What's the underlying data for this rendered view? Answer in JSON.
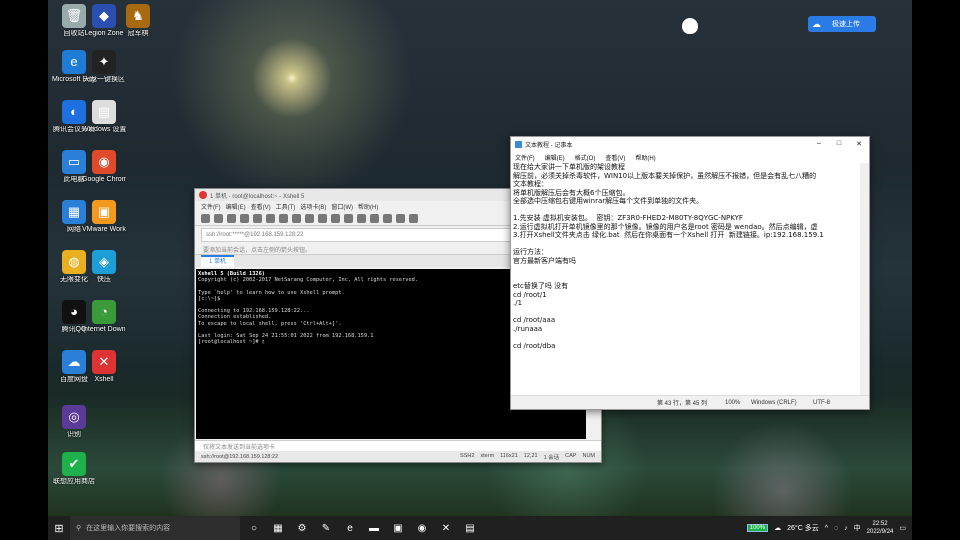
{
  "desktop": {
    "icons": [
      {
        "label": "回收站",
        "icon": "recycle-bin-icon",
        "glyph": "🗑",
        "color": "#9aa"
      },
      {
        "label": "Legion Zone",
        "icon": "legion-zone-icon",
        "glyph": "◆",
        "color": "#2a4fb0"
      },
      {
        "label": "冠军棋",
        "icon": "champion-chess-icon",
        "glyph": "♞",
        "color": "#a86a10"
      },
      {
        "label": "Microsoft Edge",
        "icon": "edge-icon",
        "glyph": "e",
        "color": "#1e7bd6"
      },
      {
        "label": "天龙一键换区",
        "icon": "tianlong-icon",
        "glyph": "✦",
        "color": "#222"
      },
      {
        "label": "腾讯会议开发",
        "icon": "tencent-meeting-icon",
        "glyph": "◐",
        "color": "#1e6fe0"
      },
      {
        "label": "Windows 设置 - 快...",
        "icon": "windows-settings-icon",
        "glyph": "▤",
        "color": "#ddd"
      },
      {
        "label": "此电脑",
        "icon": "this-pc-icon",
        "glyph": "▭",
        "color": "#2a7fd8"
      },
      {
        "label": "Google Chrome",
        "icon": "chrome-icon",
        "glyph": "◉",
        "color": "#e04a2a"
      },
      {
        "label": "网络",
        "icon": "network-icon",
        "glyph": "▦",
        "color": "#2a7fd8"
      },
      {
        "label": "VMware Workstation",
        "icon": "vmware-icon",
        "glyph": "▣",
        "color": "#f39a1e"
      },
      {
        "label": "无限变化",
        "icon": "game-icon",
        "glyph": "◍",
        "color": "#e8b01e"
      },
      {
        "label": "快压",
        "icon": "kuaiya-icon",
        "glyph": "◈",
        "color": "#1e9ed8"
      },
      {
        "label": "腾讯QQ",
        "icon": "qq-icon",
        "glyph": "◕",
        "color": "#111"
      },
      {
        "label": "Internet Download",
        "icon": "idm-icon",
        "glyph": "◔",
        "color": "#3a9a3a"
      },
      {
        "label": "百度网盘",
        "icon": "baidu-netdisk-icon",
        "glyph": "☁",
        "color": "#2a7fd8"
      },
      {
        "label": "Xshell",
        "icon": "xshell-icon",
        "glyph": "✕",
        "color": "#d33"
      },
      {
        "label": "识别",
        "icon": "recognition-icon",
        "glyph": "◎",
        "color": "#5b3a9a"
      },
      {
        "label": "联想应用商店",
        "icon": "lenovo-store-icon",
        "glyph": "✔",
        "color": "#1eb04a"
      }
    ],
    "upload_button": "极速上传"
  },
  "xshell": {
    "title": "1 单机 - root@localhost:~ - Xshell 5",
    "menu": [
      "文件(F)",
      "编辑(E)",
      "查看(V)",
      "工具(T)",
      "选项卡(B)",
      "窗口(W)",
      "帮助(H)"
    ],
    "address": "ssh://root:*****@192.168.159.128:22",
    "hint": "要添加当前会话，点击左侧的箭头按钮。",
    "tab": "1 单机",
    "terminal": [
      {
        "text": "Xshell 5 (Build 1326)",
        "bold": true
      },
      {
        "text": "Copyright (c) 2002-2017 NetSarang Computer, Inc. All rights reserved.",
        "bold": false
      },
      {
        "text": "",
        "bold": false
      },
      {
        "text": "Type `help' to learn how to use Xshell prompt.",
        "bold": false
      },
      {
        "text": "[c:\\~]$",
        "bold": false
      },
      {
        "text": "",
        "bold": false
      },
      {
        "text": "Connecting to 192.168.159.128:22...",
        "bold": false
      },
      {
        "text": "Connection established.",
        "bold": false
      },
      {
        "text": "To escape to local shell, press 'Ctrl+Alt+]'.",
        "bold": false
      },
      {
        "text": "",
        "bold": false
      },
      {
        "text": "Last login: Sat Sep 24 21:55:01 2022 from 192.168.159.1",
        "bold": false
      },
      {
        "text": "[root@localhost ~]# ▯",
        "bold": false
      }
    ],
    "input_hint": "仅将文本发送到当前选项卡",
    "status_left": "ssh://root@192.168.159.128:22",
    "status_right": [
      "SSH2",
      "xterm",
      "116x21",
      "12,21",
      "1 会话",
      "CAP",
      "NUM"
    ]
  },
  "notepad": {
    "title": "文本教程 - 记事本",
    "menu": [
      "文件(F)",
      "编辑(E)",
      "格式(O)",
      "查看(V)",
      "帮助(H)"
    ],
    "lines": [
      "现在给大家讲一下单机版的架设教程",
      "解压前，必须关掉杀毒软件，WIN10以上版本要关掉保护，虽然解压不报错，但是会有乱七八糟的",
      "文本教程：",
      "将单机版解压后会有大概6个压缩包。",
      "全部选中压缩包右键用winrar解压每个文件到单独的文件夹。",
      "",
      "1.先安装 虚拟机安装包。  密钥：ZF3R0-FHED2-M80TY-8QYGC-NPKYF",
      "2.运行虚拟机打开单机镜像里的那个镜像。镜像的用户名是root 密码是 wendao。然后点编辑，虚",
      "3.打开Xshell文件夹点击 绿化.bat  然后在你桌面有一个Xshell 打开  新建链接。ip:192.168.159.1",
      "",
      "运行方法：",
      "官方最新客户端有吗",
      "",
      "",
      "etc替换了吗 没有",
      "cd /root/1",
      "./1",
      "",
      "cd /root/aaa",
      "./runaaa",
      "",
      "cd /root/dba"
    ],
    "status": {
      "position": "第 43 行，第 45 列",
      "zoom": "100%",
      "eol": "Windows (CRLF)",
      "encoding": "UTF-8"
    }
  },
  "taskbar": {
    "search_placeholder": "在这里输入你要搜索的内容",
    "battery": "100%",
    "weather": "26°C 多云",
    "ime": "中",
    "time": "22:52",
    "date": "2022/9/24"
  }
}
